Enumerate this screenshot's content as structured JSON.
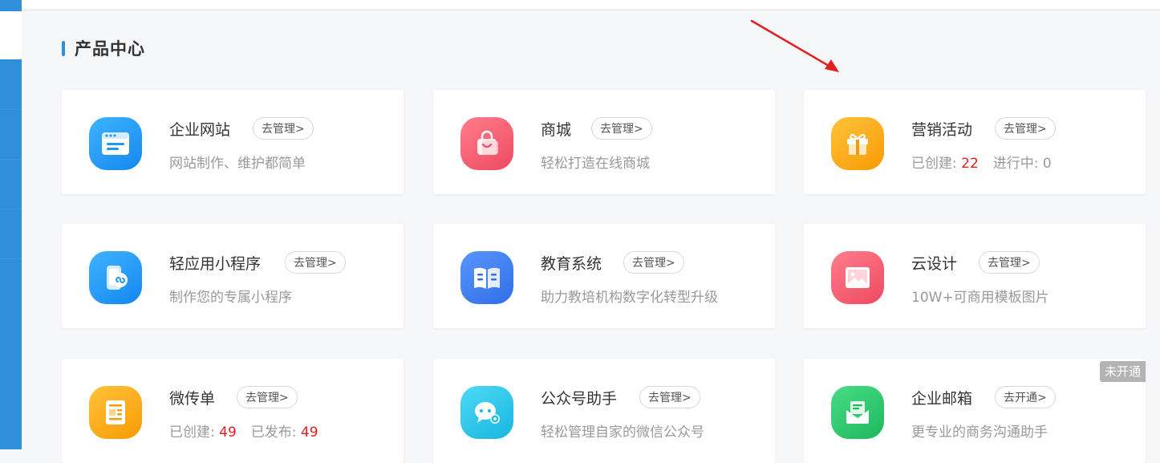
{
  "section": {
    "title": "产品中心"
  },
  "cards": [
    {
      "name": "企业网站",
      "manage_label": "去管理>",
      "desc": "网站制作、维护都简单",
      "icon": "browser-window-icon",
      "color": "#1f9bf5"
    },
    {
      "name": "商城",
      "manage_label": "去管理>",
      "desc": "轻松打造在线商城",
      "icon": "shopping-bag-icon",
      "color": "#f25a6e"
    },
    {
      "name": "营销活动",
      "manage_label": "去管理>",
      "stats": {
        "created_label": "已创建:",
        "created_value": "22",
        "active_label": "进行中:",
        "active_value": "0"
      },
      "icon": "gift-box-icon",
      "color": "#fdaa12"
    },
    {
      "name": "轻应用小程序",
      "manage_label": "去管理>",
      "desc": "制作您的专属小程序",
      "icon": "mini-program-phone-icon",
      "color": "#1f9bf5"
    },
    {
      "name": "教育系统",
      "manage_label": "去管理>",
      "desc": "助力教培机构数字化转型升级",
      "icon": "open-book-icon",
      "color": "#3d7ef0"
    },
    {
      "name": "云设计",
      "manage_label": "去管理>",
      "desc": "10W+可商用模板图片",
      "icon": "image-picture-icon",
      "color": "#f25a6e"
    },
    {
      "name": "微传单",
      "manage_label": "去管理>",
      "stats": {
        "created_label": "已创建:",
        "created_value": "49",
        "published_label": "已发布:",
        "published_value": "49"
      },
      "icon": "flyer-document-icon",
      "color": "#fdaa12"
    },
    {
      "name": "公众号助手",
      "manage_label": "去管理>",
      "desc": "轻松管理自家的微信公众号",
      "icon": "wechat-chat-gear-icon",
      "color": "#22c6e8"
    },
    {
      "name": "企业邮箱",
      "manage_label": "去开通>",
      "desc": "更专业的商务沟通助手",
      "badge": "未开通",
      "icon": "envelope-mail-icon",
      "color": "#28c76a"
    }
  ]
}
